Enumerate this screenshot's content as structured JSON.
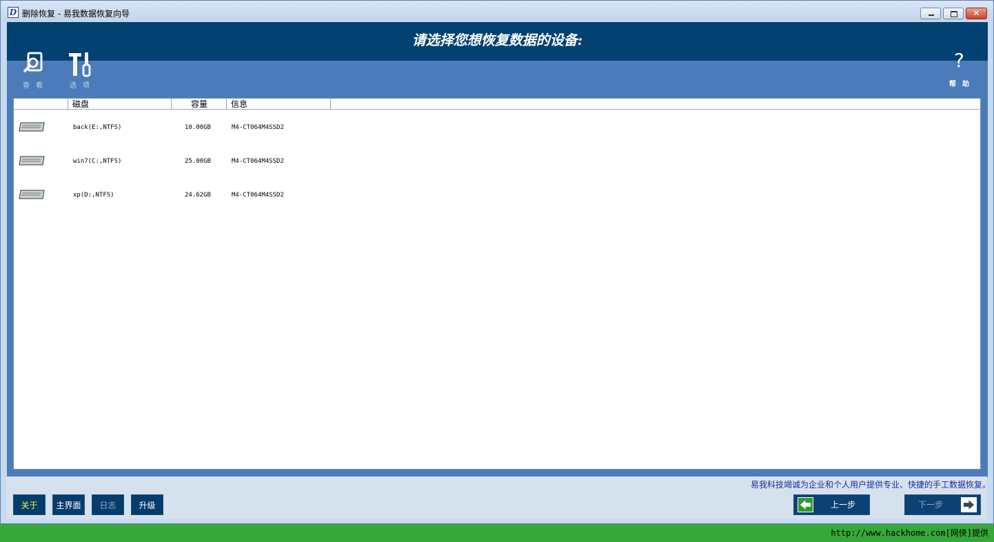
{
  "window": {
    "icon_letter": "D",
    "title": "删除恢复 - 易我数据恢复向导",
    "close_glyph": "✕"
  },
  "header": {
    "title": "请选择您想恢复数据的设备:"
  },
  "toolbar": {
    "view_label": "查看",
    "options_label": "选项",
    "help_glyph": "?",
    "help_label": "帮助"
  },
  "list": {
    "columns": [
      "磁盘",
      "容量",
      "信息"
    ],
    "rows": [
      {
        "disk": "back(E:,NTFS)",
        "capacity": "10.00GB",
        "info": "M4-CT064M4SSD2"
      },
      {
        "disk": "win7(C:,NTFS)",
        "capacity": "25.00GB",
        "info": "M4-CT064M4SSD2"
      },
      {
        "disk": "xp(D:,NTFS)",
        "capacity": "24.62GB",
        "info": "M4-CT064M4SSD2"
      }
    ]
  },
  "bottom": {
    "slogan": "易我科技竭诚为企业和个人用户提供专业、快捷的手工数据恢复。",
    "about": "关于",
    "main": "主界面",
    "log": "日志",
    "upgrade": "升级",
    "prev": "上一步",
    "next": "下一步"
  },
  "footer": {
    "credit": "http://www.hackhome.com[网侠]提供"
  },
  "colors": {
    "header_blue": "#024172",
    "toolbar_blue": "#4c7bb9",
    "taskbar_green": "#36a83a",
    "active_yellow": "#ffef3a",
    "slogan_blue": "#1b2ea0"
  }
}
